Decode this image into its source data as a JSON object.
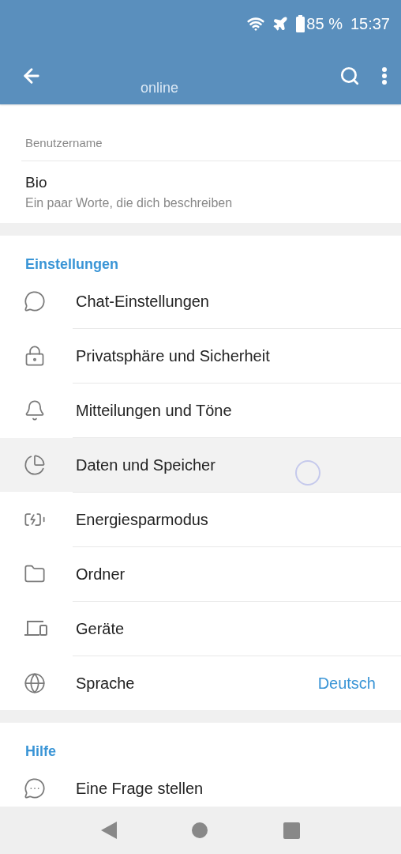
{
  "status_bar": {
    "battery": "85 %",
    "time": "15:37"
  },
  "toolbar": {
    "subtitle": "online"
  },
  "profile": {
    "username_label": "Benutzername",
    "bio_title": "Bio",
    "bio_hint": "Ein paar Worte, die dich beschreiben"
  },
  "sections": [
    {
      "title": "Einstellungen",
      "items": [
        {
          "label": "Chat-Einstellungen",
          "selected": false
        },
        {
          "label": "Privatsphäre und Sicherheit",
          "selected": false
        },
        {
          "label": "Mitteilungen und Töne",
          "selected": false
        },
        {
          "label": "Daten und Speicher",
          "selected": true
        },
        {
          "label": "Energiesparmodus",
          "selected": false
        },
        {
          "label": "Ordner",
          "selected": false
        },
        {
          "label": "Geräte",
          "selected": false
        },
        {
          "label": "Sprache",
          "value": "Deutsch",
          "selected": false
        }
      ]
    },
    {
      "title": "Hilfe",
      "items": [
        {
          "label": "Eine Frage stellen",
          "selected": false
        }
      ]
    }
  ]
}
